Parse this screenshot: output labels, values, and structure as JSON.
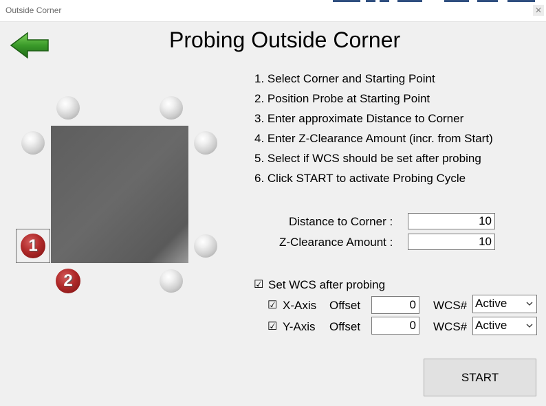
{
  "window": {
    "title": "Outside Corner",
    "close_glyph": "✕"
  },
  "page": {
    "title": "Probing Outside Corner"
  },
  "instructions": [
    "1. Select Corner and Starting Point",
    "2. Position Probe at Starting Point",
    "3. Enter approximate Distance to Corner",
    "4. Enter Z-Clearance Amount (incr. from Start)",
    "5. Select if WCS should be set after probing",
    "6. Click START to activate Probing Cycle"
  ],
  "diagram": {
    "corner_marker": "1",
    "start_marker": "2"
  },
  "fields": {
    "distance_label": "Distance to Corner :",
    "distance_value": "10",
    "zclear_label": "Z-Clearance Amount :",
    "zclear_value": "10"
  },
  "wcs": {
    "set_label": "Set WCS after probing",
    "set_checked": "☑",
    "x_axis": {
      "check": "☑",
      "label": "X-Axis",
      "offset_label": "Offset",
      "offset_value": "0",
      "wcs_label": "WCS#",
      "wcs_value": "Active"
    },
    "y_axis": {
      "check": "☑",
      "label": "Y-Axis",
      "offset_label": "Offset",
      "offset_value": "0",
      "wcs_label": "WCS#",
      "wcs_value": "Active"
    }
  },
  "start_button": "START",
  "colors": {
    "arrow_green": "#3a9a2a",
    "marker_red": "#b02a2a",
    "workpiece_gray": "#646464"
  },
  "icons": {
    "back": "back-arrow-icon",
    "close": "close-icon",
    "dropdown": "chevron-down-icon",
    "check": "checkmark-icon"
  }
}
